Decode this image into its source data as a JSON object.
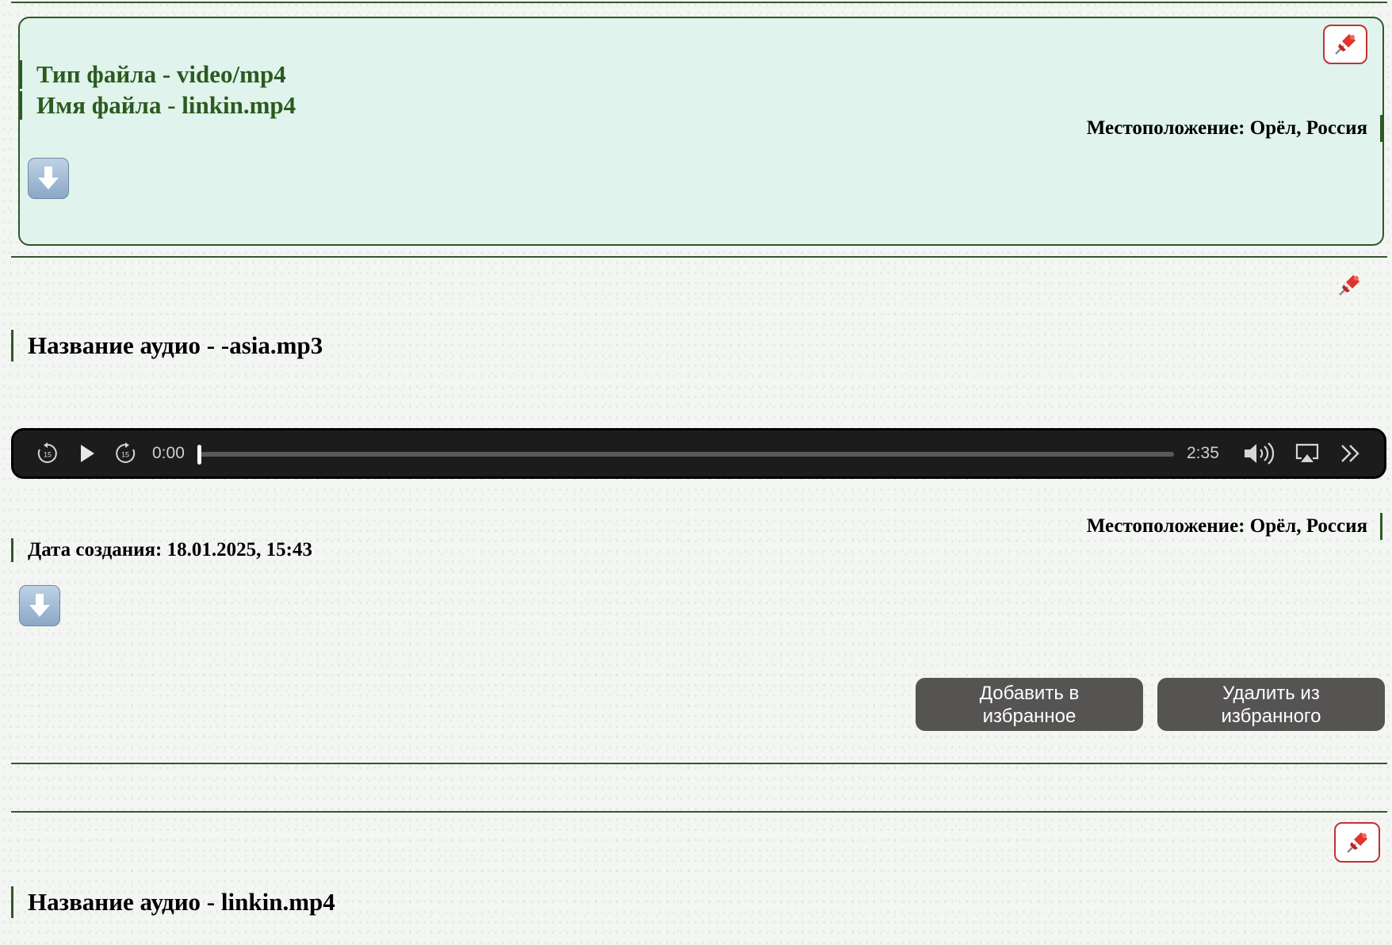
{
  "card_video": {
    "file_type": "Тип файла - video/mp4",
    "file_name": "Имя файла - linkin.mp4",
    "location": "Местоположение: Орёл, Россия"
  },
  "card_audio": {
    "title": "Название аудио - -asia.mp3",
    "player": {
      "current_time": "0:00",
      "duration": "2:35",
      "progress": 0
    },
    "location": "Местоположение: Орёл, Россия",
    "created": "Дата создания: 18.01.2025, 15:43",
    "add_favorite": "Добавить в\nизбранное",
    "remove_favorite": "Удалить из\nизбранного"
  },
  "card_audio_2": {
    "title": "Название аудио - linkin.mp4"
  },
  "icons": {
    "pin": "pushpin-icon",
    "download": "download-arrow-icon",
    "rewind": "rewind-15-icon",
    "play": "play-icon",
    "forward": "forward-15-icon",
    "volume": "volume-icon",
    "airplay": "airplay-icon",
    "more": "chevron-double-right-icon"
  },
  "colors": {
    "accent_green": "#2b5a1f",
    "card_highlight_bg": "#e0f3ec",
    "pin_border": "#c43131",
    "button_bg": "#565353",
    "player_bg": "#1c1c1c"
  }
}
